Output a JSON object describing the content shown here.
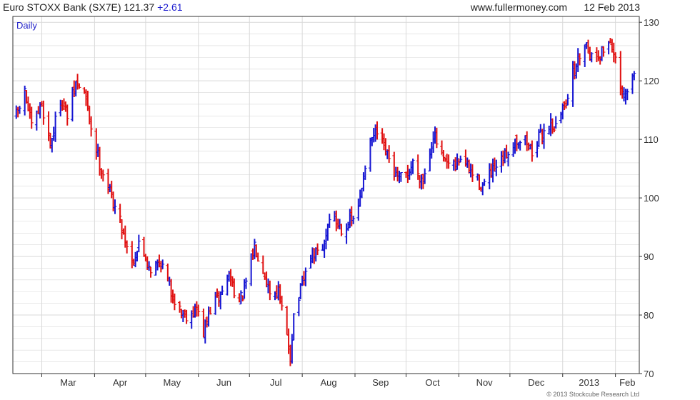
{
  "header": {
    "title": "Euro STOXX Bank (SX7E)",
    "last": "121.37",
    "change": "+2.61",
    "site": "www.fullermoney.com",
    "date": "12 Feb 2013"
  },
  "chart_data": {
    "type": "ohlc",
    "title": "Euro STOXX Bank (SX7E)",
    "interval_label": "Daily",
    "copyright": "© 2013 Stockcube Research Ltd",
    "ylim": [
      70,
      131
    ],
    "yticks": [
      70,
      80,
      90,
      100,
      110,
      120,
      130
    ],
    "x_months": [
      "Mar",
      "Apr",
      "May",
      "Jun",
      "Jul",
      "Aug",
      "Sep",
      "Oct",
      "Nov",
      "Dec",
      "2013",
      "Feb"
    ],
    "grid": true,
    "colors": {
      "up": "#1414d2",
      "down": "#e01010",
      "grid": "#d9d9d9",
      "axis": "#333333"
    },
    "anchors": [
      {
        "d": "2012-02-15",
        "v": 114
      },
      {
        "d": "2012-02-20",
        "v": 118
      },
      {
        "d": "2012-02-24",
        "v": 112
      },
      {
        "d": "2012-03-01",
        "v": 116
      },
      {
        "d": "2012-03-06",
        "v": 109
      },
      {
        "d": "2012-03-12",
        "v": 117
      },
      {
        "d": "2012-03-16",
        "v": 114
      },
      {
        "d": "2012-03-21",
        "v": 119.5
      },
      {
        "d": "2012-03-26",
        "v": 118
      },
      {
        "d": "2012-03-30",
        "v": 112
      },
      {
        "d": "2012-04-04",
        "v": 106
      },
      {
        "d": "2012-04-10",
        "v": 101
      },
      {
        "d": "2012-04-16",
        "v": 96
      },
      {
        "d": "2012-04-23",
        "v": 89
      },
      {
        "d": "2012-04-27",
        "v": 92
      },
      {
        "d": "2012-05-04",
        "v": 88
      },
      {
        "d": "2012-05-10",
        "v": 89
      },
      {
        "d": "2012-05-16",
        "v": 84
      },
      {
        "d": "2012-05-21",
        "v": 81
      },
      {
        "d": "2012-05-24",
        "v": 80
      },
      {
        "d": "2012-05-31",
        "v": 81
      },
      {
        "d": "2012-06-04",
        "v": 77
      },
      {
        "d": "2012-06-08",
        "v": 81
      },
      {
        "d": "2012-06-13",
        "v": 83
      },
      {
        "d": "2012-06-19",
        "v": 87
      },
      {
        "d": "2012-06-25",
        "v": 82
      },
      {
        "d": "2012-06-28",
        "v": 84
      },
      {
        "d": "2012-07-04",
        "v": 92
      },
      {
        "d": "2012-07-09",
        "v": 88
      },
      {
        "d": "2012-07-13",
        "v": 84
      },
      {
        "d": "2012-07-18",
        "v": 84
      },
      {
        "d": "2012-07-23",
        "v": 76
      },
      {
        "d": "2012-07-25",
        "v": 73
      },
      {
        "d": "2012-07-27",
        "v": 80
      },
      {
        "d": "2012-07-31",
        "v": 84
      },
      {
        "d": "2012-08-06",
        "v": 90
      },
      {
        "d": "2012-08-13",
        "v": 91
      },
      {
        "d": "2012-08-17",
        "v": 97
      },
      {
        "d": "2012-08-24",
        "v": 95
      },
      {
        "d": "2012-08-30",
        "v": 96
      },
      {
        "d": "2012-09-03",
        "v": 98
      },
      {
        "d": "2012-09-07",
        "v": 106
      },
      {
        "d": "2012-09-11",
        "v": 110
      },
      {
        "d": "2012-09-14",
        "v": 111
      },
      {
        "d": "2012-09-20",
        "v": 107
      },
      {
        "d": "2012-09-26",
        "v": 103
      },
      {
        "d": "2012-10-02",
        "v": 104
      },
      {
        "d": "2012-10-05",
        "v": 106
      },
      {
        "d": "2012-10-11",
        "v": 103
      },
      {
        "d": "2012-10-17",
        "v": 111
      },
      {
        "d": "2012-10-23",
        "v": 106
      },
      {
        "d": "2012-10-29",
        "v": 105
      },
      {
        "d": "2012-11-02",
        "v": 107
      },
      {
        "d": "2012-11-09",
        "v": 104
      },
      {
        "d": "2012-11-15",
        "v": 102
      },
      {
        "d": "2012-11-20",
        "v": 104
      },
      {
        "d": "2012-11-26",
        "v": 106
      },
      {
        "d": "2012-12-04",
        "v": 110
      },
      {
        "d": "2012-12-10",
        "v": 110
      },
      {
        "d": "2012-12-14",
        "v": 108
      },
      {
        "d": "2012-12-20",
        "v": 111
      },
      {
        "d": "2012-12-24",
        "v": 113
      },
      {
        "d": "2012-12-28",
        "v": 112
      },
      {
        "d": "2013-01-03",
        "v": 117
      },
      {
        "d": "2013-01-08",
        "v": 122
      },
      {
        "d": "2013-01-14",
        "v": 127
      },
      {
        "d": "2013-01-18",
        "v": 124
      },
      {
        "d": "2013-01-24",
        "v": 125
      },
      {
        "d": "2013-01-29",
        "v": 127
      },
      {
        "d": "2013-02-01",
        "v": 123
      },
      {
        "d": "2013-02-05",
        "v": 117
      },
      {
        "d": "2013-02-08",
        "v": 118
      },
      {
        "d": "2013-02-12",
        "v": 121.4
      }
    ]
  }
}
